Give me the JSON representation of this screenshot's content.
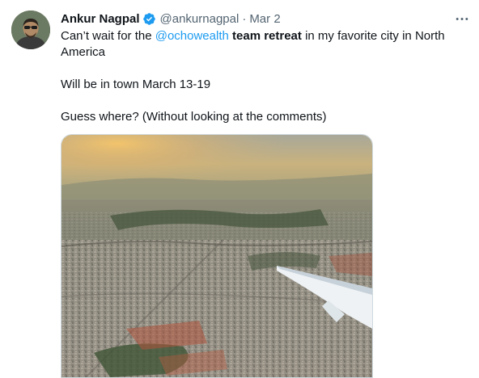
{
  "tweet": {
    "author_name": "Ankur Nagpal",
    "handle": "@ankurnagpal",
    "separator": "·",
    "date": "Mar 2",
    "text": {
      "line1_prefix": "Can’t wait for the ",
      "mention": "@ochowealth",
      "line1_space": " ",
      "bold_phrase": "team retreat",
      "line1_suffix": " in my favorite city in North America",
      "line2": "Will be in town March 13-19",
      "line3": "Guess where? (Without looking at the comments)"
    },
    "more_glyph": "···"
  },
  "icons": {
    "verified": "verified-badge-icon",
    "more": "more-options-icon"
  },
  "colors": {
    "link": "#1d9bf0",
    "secondary_text": "#536471",
    "primary_text": "#0f1419",
    "verified": "#1d9bf0"
  }
}
